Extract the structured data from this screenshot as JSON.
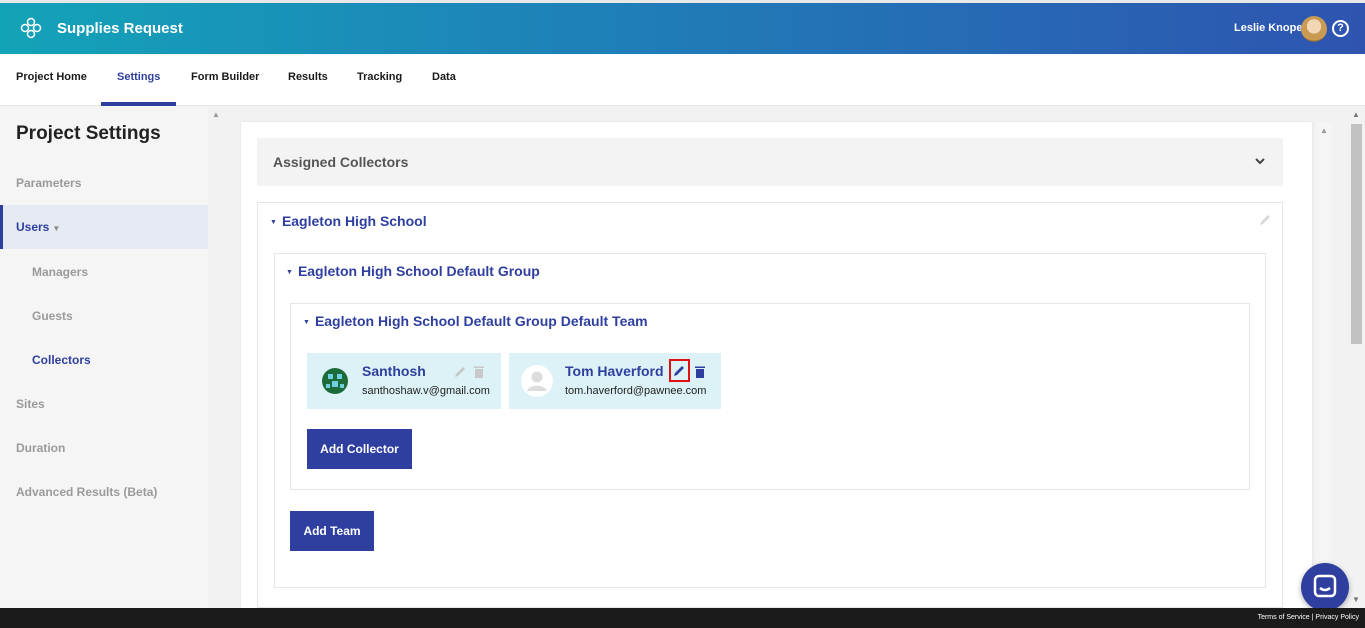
{
  "header": {
    "app_title": "Supplies Request",
    "user_name": "Leslie Knope",
    "help_glyph": "?"
  },
  "nav": {
    "tabs": [
      {
        "label": "Project Home"
      },
      {
        "label": "Settings",
        "active": true
      },
      {
        "label": "Form Builder"
      },
      {
        "label": "Results"
      },
      {
        "label": "Tracking"
      },
      {
        "label": "Data"
      }
    ]
  },
  "sidebar": {
    "title": "Project Settings",
    "items": [
      {
        "label": "Parameters"
      },
      {
        "label": "Users",
        "active": true
      },
      {
        "label": "Managers"
      },
      {
        "label": "Guests"
      },
      {
        "label": "Collectors"
      },
      {
        "label": "Sites"
      },
      {
        "label": "Duration"
      },
      {
        "label": "Advanced Results (Beta)"
      }
    ]
  },
  "main": {
    "assigned_title": "Assigned Collectors",
    "school": {
      "name": "Eagleton High School",
      "group": {
        "name": "Eagleton High School Default Group",
        "team": {
          "name": "Eagleton High School Default Group Default Team",
          "collectors": [
            {
              "name": "Santhosh",
              "email": "santhoshaw.v@gmail.com"
            },
            {
              "name": "Tom Haverford",
              "email": "tom.haverford@pawnee.com"
            }
          ],
          "add_collector_label": "Add Collector"
        },
        "add_team_label": "Add Team"
      }
    }
  },
  "footer": {
    "terms": "Terms of Service",
    "privacy": "Privacy Policy"
  },
  "colors": {
    "accent": "#2e3f9f",
    "card_bg": "#dcf2f6",
    "highlight": "#e01010"
  }
}
